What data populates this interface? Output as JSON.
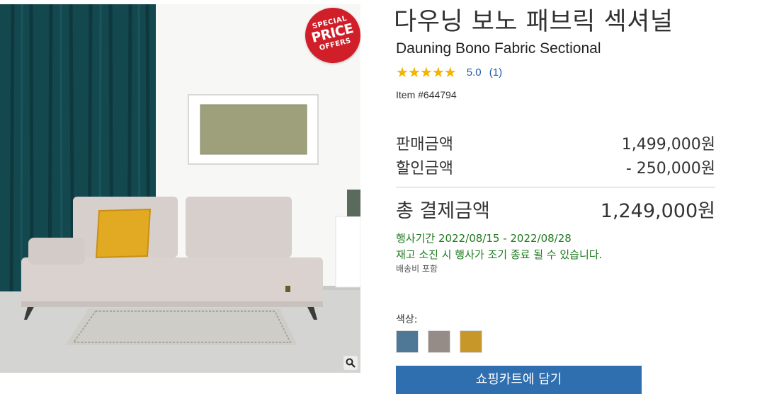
{
  "product": {
    "title_ko": "다우닝 보노 패브릭 섹셔널",
    "title_en": "Dauning Bono Fabric Sectional",
    "rating": {
      "stars": 5,
      "score": "5.0",
      "count": "(1)"
    },
    "item_label": "Item #",
    "item_number": "644794"
  },
  "badge": {
    "line1": "SPECIAL",
    "line2": "PRICE",
    "line3": "OFFERS"
  },
  "pricing": {
    "sale_label": "판매금액",
    "sale_value": "1,499,000원",
    "discount_label": "할인금액",
    "discount_value": "- 250,000원",
    "total_label": "총 결제금액",
    "total_value": "1,249,000원"
  },
  "promotion": {
    "period": "행사기간 2022/08/15 - 2022/08/28",
    "note": "재고 소진 시 행사가 조기 종료 될 수 있습니다.",
    "shipping": "배송비 포함"
  },
  "options": {
    "color_label": "색상:",
    "colors": [
      {
        "name": "blue-gray",
        "hex": "#4f7897"
      },
      {
        "name": "taupe",
        "hex": "#958b87"
      },
      {
        "name": "mustard",
        "hex": "#c8972a"
      }
    ]
  },
  "actions": {
    "add_to_cart": "쇼핑카트에 담기"
  },
  "icons": {
    "zoom": "magnifier-icon",
    "star": "star-icon"
  },
  "colors": {
    "link": "#1e5ba8",
    "promo_text": "#1f7a1f",
    "cart_button": "#2f6fb0",
    "star": "#f4b400",
    "badge": "#d11f2a"
  }
}
